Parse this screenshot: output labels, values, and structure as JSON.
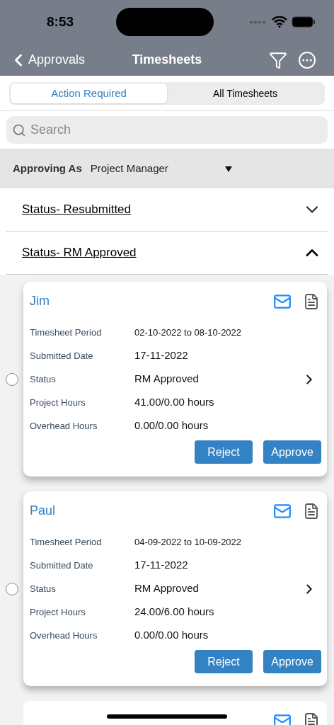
{
  "status_bar": {
    "time": "8:53"
  },
  "nav": {
    "back": "Approvals",
    "title": "Timesheets"
  },
  "tabs": [
    {
      "label": "Action Required",
      "selected": true
    },
    {
      "label": "All Timesheets",
      "selected": false
    }
  ],
  "search": {
    "placeholder": "Search"
  },
  "approving_as": {
    "label": "Approving As",
    "value": "Project Manager"
  },
  "sections": [
    {
      "title": "Status- Resubmitted",
      "expanded": false
    },
    {
      "title": "Status- RM Approved",
      "expanded": true
    }
  ],
  "cards": [
    {
      "name": "Jim",
      "selected": false,
      "fields": [
        {
          "label": "Timesheet Period",
          "value": "02-10-2022 to 08-10-2022"
        },
        {
          "label": "Submitted Date",
          "value": "17-11-2022"
        },
        {
          "label": "Status",
          "value": "RM Approved",
          "kind": "link"
        },
        {
          "label": "Project Hours",
          "value": "41.00/0.00 hours"
        },
        {
          "label": "Overhead Hours",
          "value": "0.00/0.00 hours"
        }
      ],
      "buttons": [
        "Reject",
        "Approve"
      ]
    },
    {
      "name": "Paul",
      "selected": false,
      "fields": [
        {
          "label": "Timesheet Period",
          "value": "04-09-2022 to 10-09-2022"
        },
        {
          "label": "Submitted Date",
          "value": "17-11-2022"
        },
        {
          "label": "Status",
          "value": "RM Approved",
          "kind": "link"
        },
        {
          "label": "Project Hours",
          "value": "24.00/6.00 hours"
        },
        {
          "label": "Overhead Hours",
          "value": "0.00/0.00 hours"
        }
      ],
      "buttons": [
        "Reject",
        "Approve"
      ]
    }
  ]
}
